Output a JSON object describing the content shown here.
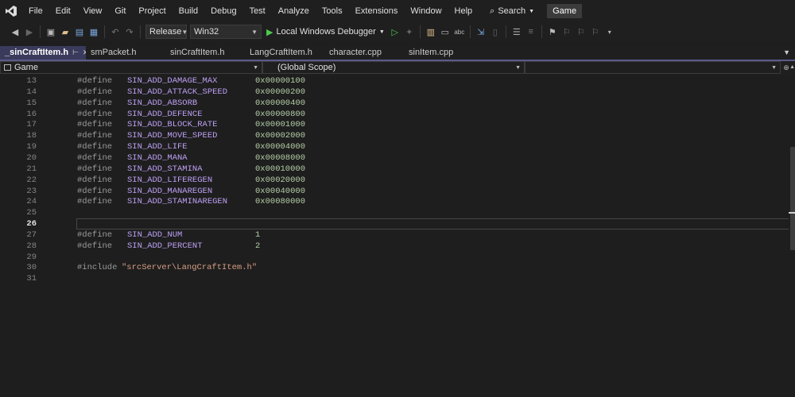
{
  "menubar": {
    "items": [
      "File",
      "Edit",
      "View",
      "Git",
      "Project",
      "Build",
      "Debug",
      "Test",
      "Analyze",
      "Tools",
      "Extensions",
      "Window",
      "Help"
    ],
    "search_label": "Search",
    "solution_name": "Game"
  },
  "toolbar": {
    "configuration": "Release",
    "platform": "Win32",
    "debugger_label": "Local Windows Debugger"
  },
  "tabs": [
    "_sinCraftItem.h",
    "smPacket.h",
    "sinCraftItem.h",
    "LangCraftItem.h",
    "character.cpp",
    "sinItem.cpp"
  ],
  "navbar": {
    "project": "Game",
    "scope": "(Global Scope)"
  },
  "code": {
    "current_line": "26",
    "lines": [
      {
        "n": "13",
        "kw": "#define",
        "name": "SIN_ADD_DAMAGE_MAX",
        "value": "0x00000100"
      },
      {
        "n": "14",
        "kw": "#define",
        "name": "SIN_ADD_ATTACK_SPEED",
        "value": "0x00000200"
      },
      {
        "n": "15",
        "kw": "#define",
        "name": "SIN_ADD_ABSORB",
        "value": "0x00000400"
      },
      {
        "n": "16",
        "kw": "#define",
        "name": "SIN_ADD_DEFENCE",
        "value": "0x00000800"
      },
      {
        "n": "17",
        "kw": "#define",
        "name": "SIN_ADD_BLOCK_RATE",
        "value": "0x00001000"
      },
      {
        "n": "18",
        "kw": "#define",
        "name": "SIN_ADD_MOVE_SPEED",
        "value": "0x00002000"
      },
      {
        "n": "19",
        "kw": "#define",
        "name": "SIN_ADD_LIFE",
        "value": "0x00004000"
      },
      {
        "n": "20",
        "kw": "#define",
        "name": "SIN_ADD_MANA",
        "value": "0x00008000"
      },
      {
        "n": "21",
        "kw": "#define",
        "name": "SIN_ADD_STAMINA",
        "value": "0x00010000"
      },
      {
        "n": "22",
        "kw": "#define",
        "name": "SIN_ADD_LIFEREGEN",
        "value": "0x00020000"
      },
      {
        "n": "23",
        "kw": "#define",
        "name": "SIN_ADD_MANAREGEN",
        "value": "0x00040000"
      },
      {
        "n": "24",
        "kw": "#define",
        "name": "SIN_ADD_STAMINAREGEN",
        "value": "0x00080000"
      },
      {
        "n": "25",
        "kw": "",
        "name": "",
        "value": ""
      },
      {
        "n": "26",
        "kw": "",
        "name": "",
        "value": ""
      },
      {
        "n": "27",
        "kw": "#define",
        "name": "SIN_ADD_NUM",
        "value": "1"
      },
      {
        "n": "28",
        "kw": "#define",
        "name": "SIN_ADD_PERCENT",
        "value": "2"
      },
      {
        "n": "29",
        "kw": "",
        "name": "",
        "value": ""
      },
      {
        "n": "30",
        "kw": "#include",
        "name": "",
        "value": "",
        "str": "\"srcServer\\LangCraftItem.h\""
      },
      {
        "n": "31",
        "kw": "",
        "name": "",
        "value": ""
      }
    ]
  }
}
